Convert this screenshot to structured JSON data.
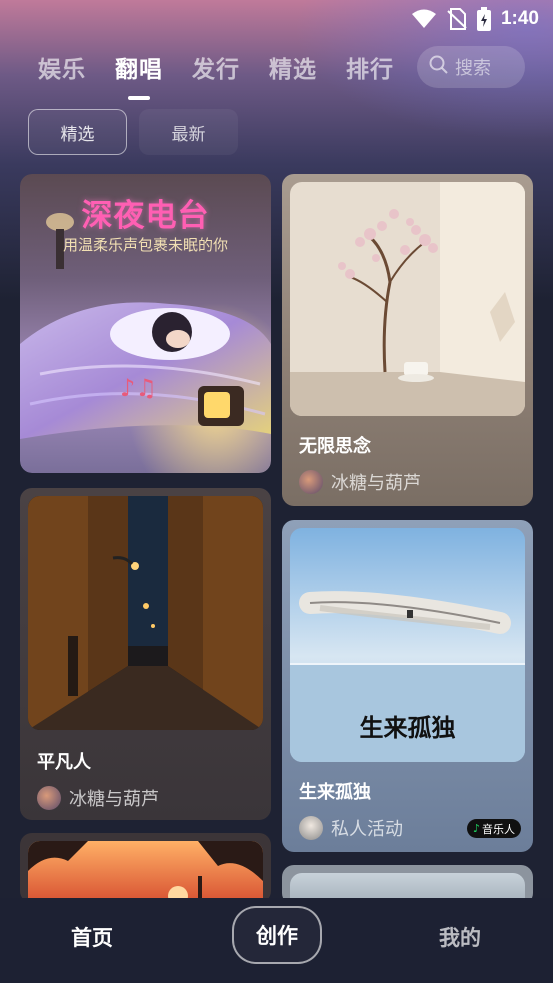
{
  "status": {
    "time": "1:40"
  },
  "tabs": [
    {
      "label": "娱乐",
      "active": false
    },
    {
      "label": "翻唱",
      "active": true
    },
    {
      "label": "发行",
      "active": false
    },
    {
      "label": "精选",
      "active": false
    },
    {
      "label": "排行",
      "active": false
    }
  ],
  "search": {
    "placeholder": "搜索"
  },
  "filters": [
    {
      "label": "精选",
      "active": true
    },
    {
      "label": "最新",
      "active": false
    }
  ],
  "cards": {
    "c1": {
      "poster_title": "深夜电台",
      "poster_subtitle": "用温柔乐声包裹未眠的你"
    },
    "c2": {
      "title": "无限思念",
      "author": "冰糖与葫芦"
    },
    "c3": {
      "title": "平凡人",
      "author": "冰糖与葫芦"
    },
    "c4": {
      "title": "生来孤独",
      "poster_text": "生来孤独",
      "author": "私人活动",
      "badge": "音乐人"
    }
  },
  "bottom_nav": {
    "home": "首页",
    "create": "创作",
    "mine": "我的"
  },
  "colors": {
    "accent_green": "#1ed760",
    "bg": "#1e2233"
  }
}
